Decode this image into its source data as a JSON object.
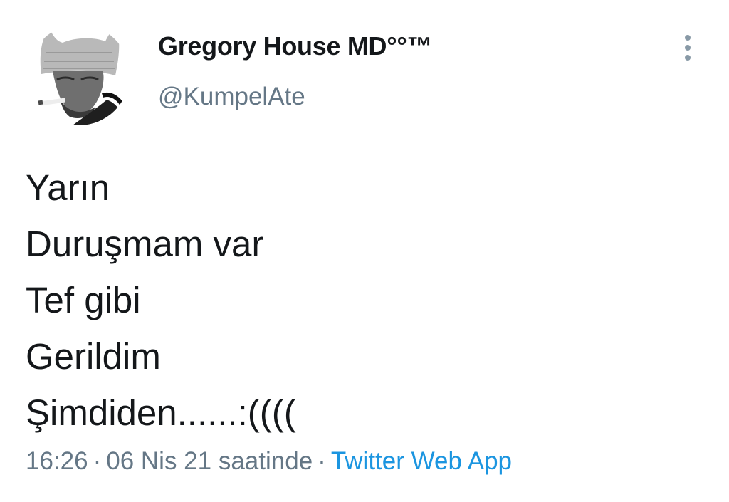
{
  "author": {
    "display_name": "Gregory House MD°°™",
    "handle": "@KumpelAte",
    "avatar_icon": "profile-photo"
  },
  "more_icon": "vertical-ellipsis-icon",
  "tweet": {
    "lines": [
      "Yarın",
      "Duruşmam var",
      "Tef gibi",
      "Gerildim",
      "Şimdiden......:(((("
    ]
  },
  "meta": {
    "time": "16:26",
    "separator": "·",
    "date": "06 Nis 21 saatinde",
    "source": "Twitter Web App"
  },
  "colors": {
    "text": "#14171a",
    "secondary": "#657786",
    "link": "#1b95e0",
    "icon": "#8899a6"
  }
}
